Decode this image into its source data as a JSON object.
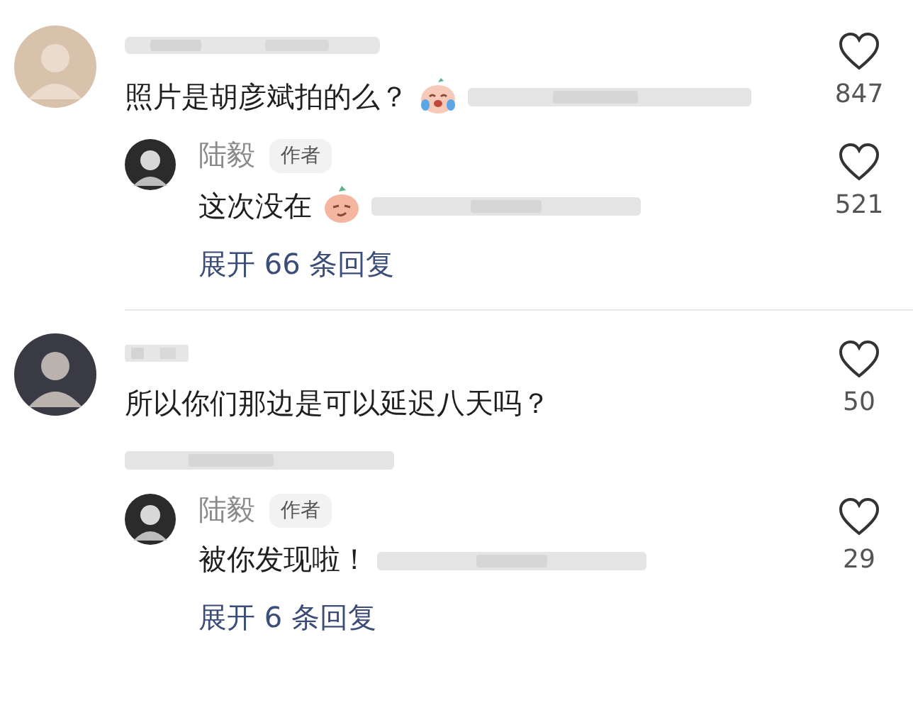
{
  "threads": [
    {
      "comment": {
        "kind": "inline",
        "color": "#d9c2ac",
        "text": "照片是胡彦斌拍的么？",
        "emojis": [
          {
            "kind": "crying"
          }
        ],
        "likes": "847"
      },
      "replies": [
        {
          "name": "陆毅",
          "badge": "作者",
          "text": "这次没在",
          "emojis": [
            {
              "kind": "smug"
            }
          ],
          "likes": "521"
        }
      ],
      "expand": "展开 66 条回复"
    },
    {
      "comment": {
        "kind": "stacked",
        "color": "#3a3a44",
        "text": "所以你们那边是可以延迟八天吗？",
        "likes": "50"
      },
      "replies": [
        {
          "name": "陆毅",
          "badge": "作者",
          "text": "被你发现啦！",
          "likes": "29"
        }
      ],
      "expand": "展开 6 条回复"
    }
  ]
}
